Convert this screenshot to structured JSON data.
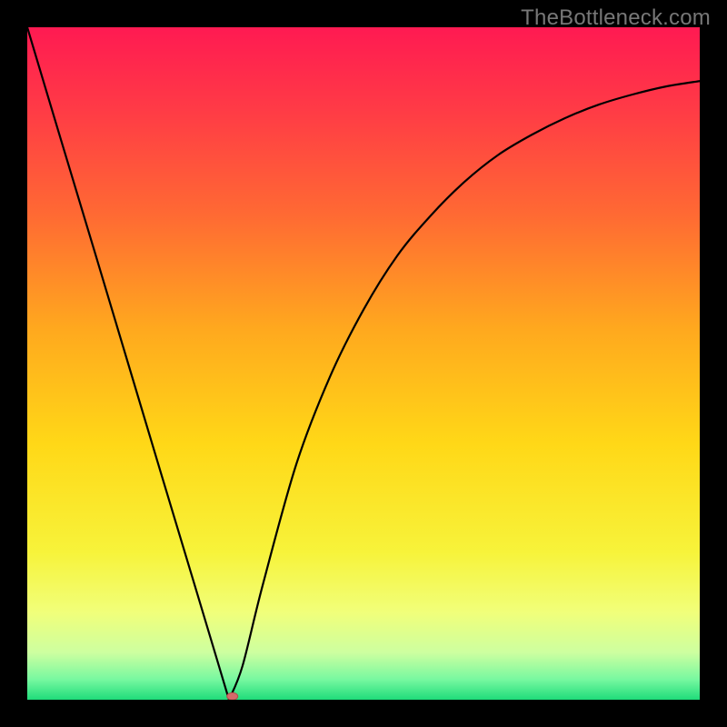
{
  "watermark": "TheBottleneck.com",
  "chart_data": {
    "type": "line",
    "title": "",
    "xlabel": "",
    "ylabel": "",
    "xlim": [
      0,
      100
    ],
    "ylim": [
      0,
      100
    ],
    "x_notch": 30,
    "series": [
      {
        "name": "curve",
        "x": [
          0,
          5,
          10,
          15,
          20,
          25,
          28,
          30,
          32,
          35,
          40,
          45,
          50,
          55,
          60,
          65,
          70,
          75,
          80,
          85,
          90,
          95,
          100
        ],
        "y": [
          100,
          83.3,
          66.7,
          50.0,
          33.3,
          16.7,
          6.7,
          0,
          5.0,
          17.0,
          35.0,
          48.0,
          58.0,
          66.0,
          72.0,
          77.0,
          81.0,
          84.0,
          86.5,
          88.5,
          90.0,
          91.2,
          92.0
        ]
      }
    ],
    "marker": {
      "x": 30.5,
      "y": 0.5
    },
    "background_gradient": {
      "stops": [
        {
          "offset": 0.0,
          "color": "#ff1a52"
        },
        {
          "offset": 0.12,
          "color": "#ff3a46"
        },
        {
          "offset": 0.28,
          "color": "#ff6a33"
        },
        {
          "offset": 0.45,
          "color": "#ffa91e"
        },
        {
          "offset": 0.62,
          "color": "#ffd817"
        },
        {
          "offset": 0.78,
          "color": "#f7f33a"
        },
        {
          "offset": 0.87,
          "color": "#f1ff7a"
        },
        {
          "offset": 0.93,
          "color": "#cdffa0"
        },
        {
          "offset": 0.97,
          "color": "#77f8a0"
        },
        {
          "offset": 1.0,
          "color": "#1fdc7a"
        }
      ]
    }
  }
}
